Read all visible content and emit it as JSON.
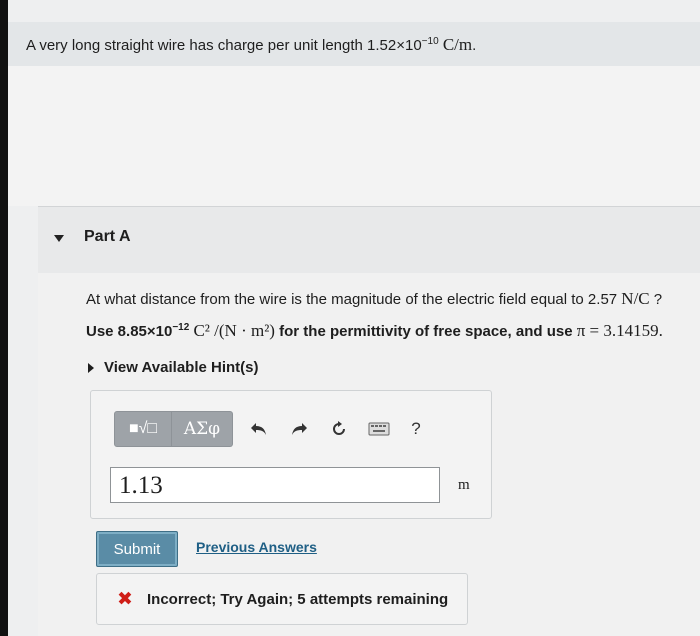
{
  "problem": {
    "text_pre": "A very long straight wire has charge per unit length 1.52×10",
    "exp": "−10",
    "unit": "C/m",
    "text_post": "."
  },
  "part": {
    "title": "Part A"
  },
  "question": {
    "text_pre": "At what distance from the wire is the magnitude of the electric field equal to 2.57 ",
    "unit": "N/C",
    "text_post": " ?"
  },
  "use_line": {
    "pre": "Use 8.85×10",
    "exp": "−12",
    "permit_unit": "C² /(N · m²)",
    "mid": " for the permittivity of free space, and use ",
    "pi": "π = 3.14159."
  },
  "hints": {
    "label": "View Available Hint(s)"
  },
  "toolbar": {
    "templates": "■√□",
    "greek": "ΑΣφ",
    "help": "?"
  },
  "answer": {
    "value": "1.13",
    "unit": "m"
  },
  "actions": {
    "submit": "Submit",
    "previous": "Previous Answers"
  },
  "feedback": {
    "icon": "✖",
    "text": "Incorrect; Try Again; 5 attempts remaining"
  },
  "colors": {
    "submit_bg": "#5a8ca6",
    "link": "#1f5f85",
    "error": "#cf1d17"
  }
}
